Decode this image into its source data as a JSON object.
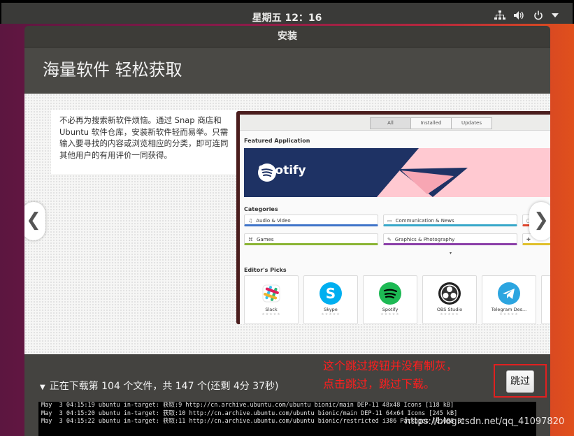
{
  "topbar": {
    "clock": "星期五 12：16",
    "icons": [
      "network-icon",
      "volume-icon",
      "power-icon",
      "menu-arrow-icon"
    ]
  },
  "window": {
    "title": "安装",
    "heading": "海量软件 轻松获取",
    "description": "不必再为搜索新软件烦恼。通过 Snap 商店和 Ubuntu 软件仓库，安装新软件轻而易举。只需输入要寻找的内容或浏览相应的分类，即可连同其他用户的有用评价一同获得。",
    "prev_arrow": "❮",
    "next_arrow": "❯",
    "store": {
      "tabs": [
        "All",
        "Installed",
        "Updates"
      ],
      "featured_label": "Featured Application",
      "banner_brand": "Spotify",
      "categories_label": "Categories",
      "categories": [
        "Audio & Video",
        "Communication & News",
        "Games",
        "Graphics & Photography"
      ],
      "editors_label": "Editor's Picks",
      "picks": [
        "Slack",
        "Skype",
        "Spotify",
        "OBS Studio",
        "Telegram Des..."
      ]
    },
    "progress": "正在下载第 104 个文件，共 147 个(还剩 4分 37秒)",
    "skip_button": "跳过",
    "log_lines": [
      "May  3 04:15:19 ubuntu in-target: 获取:9 http://cn.archive.ubuntu.com/ubuntu bionic/main DEP-11 48x48 Icons [118 kB]",
      "May  3 04:15:20 ubuntu in-target: 获取:10 http://cn.archive.ubuntu.com/ubuntu bionic/main DEP-11 64x64 Icons [245 kB]",
      "May  3 04:15:22 ubuntu in-target: 获取:11 http://cn.archive.ubuntu.com/ubuntu bionic/restricted i386 Packages [6,088 B]"
    ]
  },
  "annotation": {
    "line1": "这个跳过按钮并没有制灰，",
    "line2": "点击跳过，跳过下载。"
  },
  "watermark": "https://blog.csdn.net/qq_41097820",
  "colors": {
    "accent_red": "#ff1e1e",
    "spotify_green": "#1db954",
    "banner_navy": "#1e3264",
    "banner_pink": "#ffc9d1"
  }
}
